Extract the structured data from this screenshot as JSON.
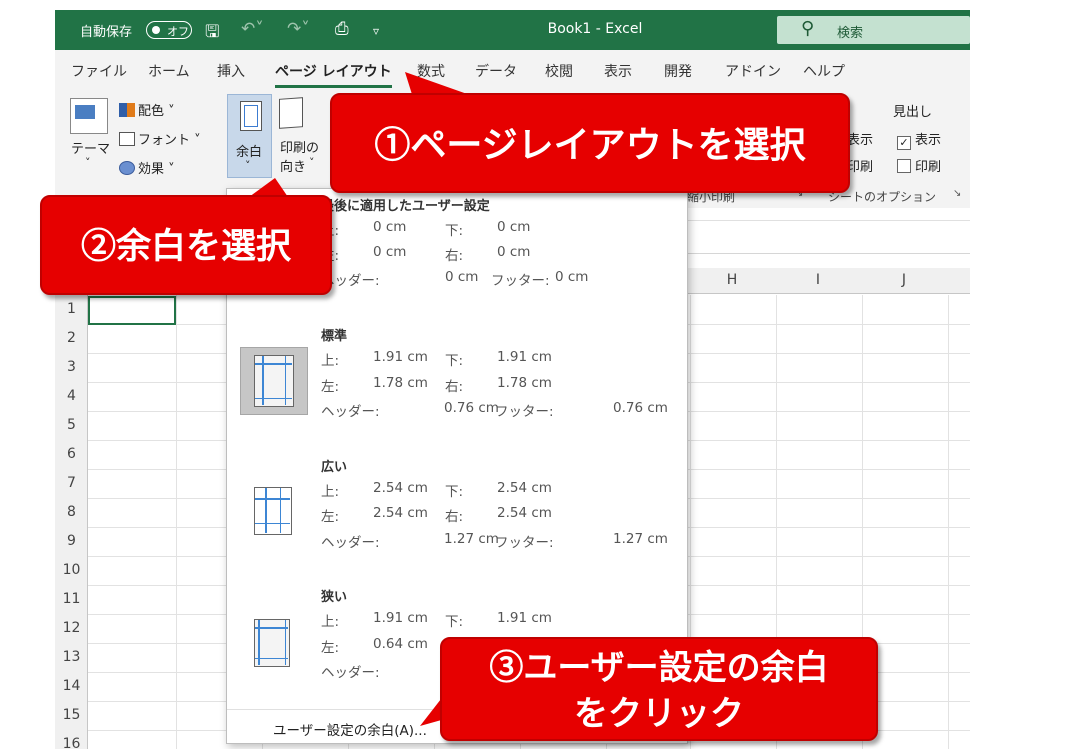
{
  "titlebar": {
    "autosave_label": "自動保存",
    "autosave_state": "オフ",
    "document_title": "Book1  -  Excel",
    "search_placeholder": "検索"
  },
  "ribbon_tabs": [
    "ファイル",
    "ホーム",
    "挿入",
    "ページ レイアウト",
    "数式",
    "データ",
    "校閲",
    "表示",
    "開発",
    "アドイン",
    "ヘルプ"
  ],
  "ribbon": {
    "themes_label": "テーマ",
    "colors_label": "配色",
    "fonts_label": "フォント",
    "effects_label": "効果",
    "margins_label": "余白",
    "orientation_label_1": "印刷の",
    "orientation_label_2": "向き",
    "sheet_options": {
      "headings_label": "見出し",
      "view_label": "表示",
      "print_label": "印刷",
      "view_left_partial": "表示",
      "print_left_partial": "印刷",
      "scale_group_partial": "縮小印刷",
      "group_label": "シートのオプション"
    }
  },
  "columns": [
    "H",
    "I",
    "J"
  ],
  "rows": [
    "1",
    "2",
    "3",
    "4",
    "5",
    "6",
    "7",
    "8",
    "9",
    "10",
    "11",
    "12",
    "13",
    "14",
    "15",
    "16"
  ],
  "margins_menu": {
    "last_custom": {
      "title": "最後に適用したユーザー設定",
      "top_label": "上:",
      "top": "0 cm",
      "bottom_label": "下:",
      "bottom": "0 cm",
      "left_label": "左:",
      "left": "0 cm",
      "right_label": "右:",
      "right": "0 cm",
      "header_label": "ヘッダー:",
      "header": "0 cm",
      "footer_label": "フッター:",
      "footer": "0 cm"
    },
    "presets": [
      {
        "title": "標準",
        "top_label": "上:",
        "top": "1.91 cm",
        "bottom_label": "下:",
        "bottom": "1.91 cm",
        "left_label": "左:",
        "left": "1.78 cm",
        "right_label": "右:",
        "right": "1.78 cm",
        "header_label": "ヘッダー:",
        "header": "0.76 cm",
        "footer_label": "フッター:",
        "footer": "0.76 cm"
      },
      {
        "title": "広い",
        "top_label": "上:",
        "top": "2.54 cm",
        "bottom_label": "下:",
        "bottom": "2.54 cm",
        "left_label": "左:",
        "left": "2.54 cm",
        "right_label": "右:",
        "right": "2.54 cm",
        "header_label": "ヘッダー:",
        "header": "1.27 cm",
        "footer_label": "フッター:",
        "footer": "1.27 cm"
      },
      {
        "title": "狭い",
        "top_label": "上:",
        "top": "1.91 cm",
        "bottom_label": "下:",
        "bottom": "1.91 cm",
        "left_label": "左:",
        "left": "0.64 cm",
        "header_label": "ヘッダー:"
      }
    ],
    "custom_margins_label": "ユーザー設定の余白(A)..."
  },
  "callouts": {
    "step1": "①ページレイアウトを選択",
    "step2": "②余白を選択",
    "step3_line1": "③ユーザー設定の余白",
    "step3_line2": "をクリック"
  },
  "colors": {
    "excel_green": "#217346",
    "callout_red": "#e60000",
    "margin_line_blue": "#3d86d4"
  }
}
